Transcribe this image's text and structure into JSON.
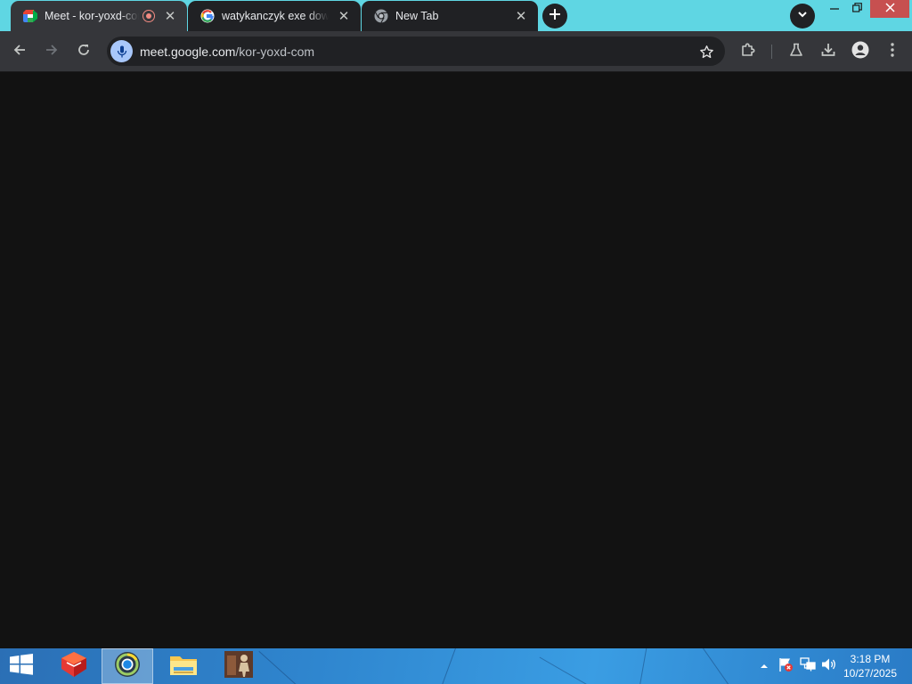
{
  "browser": {
    "tabs": [
      {
        "title": "Meet - kor-yoxd-com",
        "state": "active",
        "recording": true,
        "favicon": "google-meet-icon"
      },
      {
        "title": "watykanczyk exe download",
        "state": "inactive",
        "favicon": "google-g-icon"
      },
      {
        "title": "New Tab",
        "state": "inactive",
        "favicon": "chrome-icon"
      }
    ],
    "colors": {
      "tabstrip": "#5fd6e3",
      "toolbar": "#35363a",
      "omnibox": "#202124",
      "content": "#121212",
      "close_button": "#c75050"
    }
  },
  "omnibox": {
    "host": "meet.google.com",
    "path": "/kor-yoxd-com"
  },
  "taskbar": {
    "apps": [
      {
        "name": "windows-start-icon"
      },
      {
        "name": "foxit-reader-icon"
      },
      {
        "name": "chrome-canary-icon",
        "active": true
      },
      {
        "name": "file-explorer-icon"
      },
      {
        "name": "photo-app-icon"
      }
    ],
    "tray_icons": [
      "chevron-up-icon",
      "flag-alert-icon",
      "network-icon",
      "volume-icon"
    ]
  },
  "clock": {
    "time": "3:18 PM",
    "date": "10/27/2025"
  }
}
